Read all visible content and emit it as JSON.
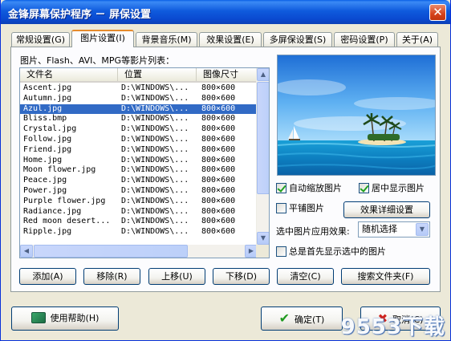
{
  "window": {
    "title": "金锋屏幕保护程序 － 屏保设置",
    "close_glyph": "✕"
  },
  "tabs": [
    {
      "label": "常规设置(G)"
    },
    {
      "label": "图片设置(I)"
    },
    {
      "label": "背景音乐(M)"
    },
    {
      "label": "效果设置(E)"
    },
    {
      "label": "多屏保设置(S)"
    },
    {
      "label": "密码设置(P)"
    },
    {
      "label": "关于(A)"
    }
  ],
  "active_tab": "图片设置(I)",
  "list": {
    "caption": "图片、Flash、AVI、MPG等影片列表：",
    "headers": {
      "name": "文件名",
      "location": "位置",
      "size": "图像尺寸"
    },
    "rows": [
      {
        "name": "Ascent.jpg",
        "location": "D:\\WINDOWS\\...",
        "size": "800×600"
      },
      {
        "name": "Autumn.jpg",
        "location": "D:\\WINDOWS\\...",
        "size": "800×600"
      },
      {
        "name": "Azul.jpg",
        "location": "D:\\WINDOWS\\...",
        "size": "800×600"
      },
      {
        "name": "Bliss.bmp",
        "location": "D:\\WINDOWS\\...",
        "size": "800×600"
      },
      {
        "name": "Crystal.jpg",
        "location": "D:\\WINDOWS\\...",
        "size": "800×600"
      },
      {
        "name": "Follow.jpg",
        "location": "D:\\WINDOWS\\...",
        "size": "800×600"
      },
      {
        "name": "Friend.jpg",
        "location": "D:\\WINDOWS\\...",
        "size": "800×600"
      },
      {
        "name": "Home.jpg",
        "location": "D:\\WINDOWS\\...",
        "size": "800×600"
      },
      {
        "name": "Moon flower.jpg",
        "location": "D:\\WINDOWS\\...",
        "size": "800×600"
      },
      {
        "name": "Peace.jpg",
        "location": "D:\\WINDOWS\\...",
        "size": "800×600"
      },
      {
        "name": "Power.jpg",
        "location": "D:\\WINDOWS\\...",
        "size": "800×600"
      },
      {
        "name": "Purple flower.jpg",
        "location": "D:\\WINDOWS\\...",
        "size": "800×600"
      },
      {
        "name": "Radiance.jpg",
        "location": "D:\\WINDOWS\\...",
        "size": "800×600"
      },
      {
        "name": "Red moon desert...",
        "location": "D:\\WINDOWS\\...",
        "size": "800×600"
      },
      {
        "name": "Ripple.jpg",
        "location": "D:\\WINDOWS\\...",
        "size": "800×600"
      }
    ],
    "selected_index": 2
  },
  "options": {
    "auto_scale_label": "自动缩放图片",
    "auto_scale_checked": true,
    "center_label": "居中显示图片",
    "center_checked": true,
    "tile_label": "平铺图片",
    "tile_checked": false,
    "effect_details_button": "效果详细设置",
    "effect_select_label": "选中图片应用效果:",
    "effect_select_value": "随机选择",
    "show_selected_first_label": "总是首先显示选中的图片",
    "show_selected_first_checked": false
  },
  "list_buttons": {
    "add": "添加(A)",
    "remove": "移除(R)",
    "move_up": "上移(U)",
    "move_down": "下移(D)",
    "clear": "清空(C)",
    "search_folder": "搜索文件夹(F)"
  },
  "footer": {
    "help": "使用帮助(H)",
    "ok": "确定(T)",
    "cancel": "取消(C)"
  },
  "watermark": "9553下载",
  "colors": {
    "title_bar": "#0a49d0",
    "selection": "#316ac5",
    "check_mark": "#21a121",
    "active_tab_accent": "#e68b2c"
  }
}
